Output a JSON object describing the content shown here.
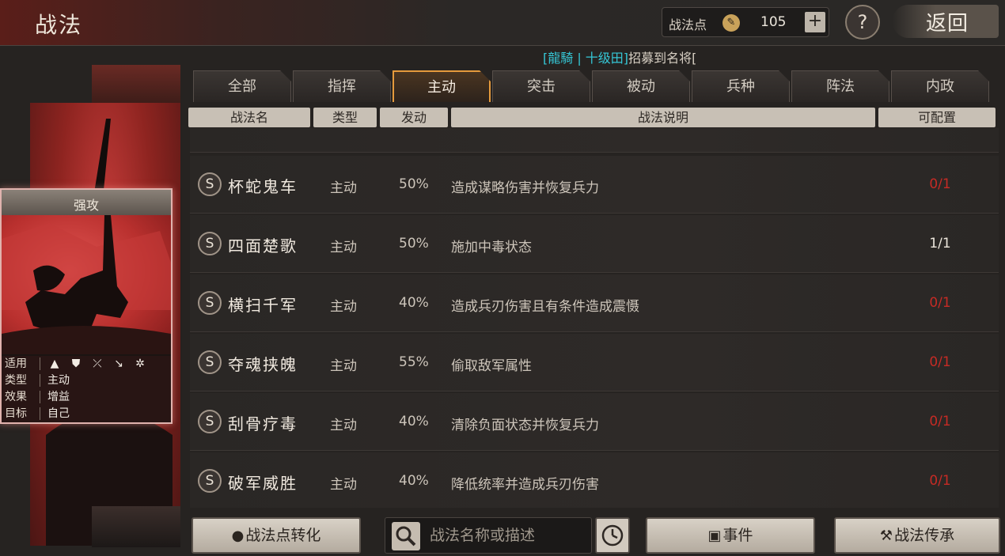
{
  "header": {
    "title": "战法",
    "points_label": "战法点",
    "points_value": "105",
    "add_label": "+",
    "help_label": "?",
    "back_label": "返回"
  },
  "ticker": {
    "tag": "[龍騎 | 十级田]",
    "text": "招募到名将["
  },
  "card": {
    "title": "强攻",
    "rows": [
      {
        "key": "适用",
        "value": ""
      },
      {
        "key": "类型",
        "value": "主动"
      },
      {
        "key": "效果",
        "value": "增益"
      },
      {
        "key": "目标",
        "value": "自己"
      }
    ],
    "applicable_icons": [
      "cavalry-icon",
      "shield-icon",
      "bow-icon",
      "spear-icon",
      "wheel-icon"
    ]
  },
  "tabs": [
    "全部",
    "指挥",
    "主动",
    "突击",
    "被动",
    "兵种",
    "阵法",
    "内政"
  ],
  "active_tab": "主动",
  "columns": [
    "战法名",
    "类型",
    "发动",
    "战法说明",
    "可配置"
  ],
  "skills": [
    {
      "grade": "S",
      "name": "杯蛇鬼车",
      "type": "主动",
      "rate": "50%",
      "desc": "造成谋略伤害并恢复兵力",
      "config": "0/1",
      "available": false
    },
    {
      "grade": "S",
      "name": "四面楚歌",
      "type": "主动",
      "rate": "50%",
      "desc": "施加中毒状态",
      "config": "1/1",
      "available": true
    },
    {
      "grade": "S",
      "name": "横扫千军",
      "type": "主动",
      "rate": "40%",
      "desc": "造成兵刃伤害且有条件造成震慑",
      "config": "0/1",
      "available": false
    },
    {
      "grade": "S",
      "name": "夺魂挟魄",
      "type": "主动",
      "rate": "55%",
      "desc": "偷取敌军属性",
      "config": "0/1",
      "available": false
    },
    {
      "grade": "S",
      "name": "刮骨疗毒",
      "type": "主动",
      "rate": "40%",
      "desc": "清除负面状态并恢复兵力",
      "config": "0/1",
      "available": false
    },
    {
      "grade": "S",
      "name": "破军威胜",
      "type": "主动",
      "rate": "40%",
      "desc": "降低统率并造成兵刃伤害",
      "config": "0/1",
      "available": false
    }
  ],
  "bottom": {
    "convert_label": "战法点转化",
    "search_placeholder": "战法名称或描述",
    "events_label": "事件",
    "inherit_label": "战法传承"
  },
  "colors": {
    "accent": "#e59a3c",
    "unavailable": "#c62b25",
    "ticker": "#35c7d6"
  }
}
